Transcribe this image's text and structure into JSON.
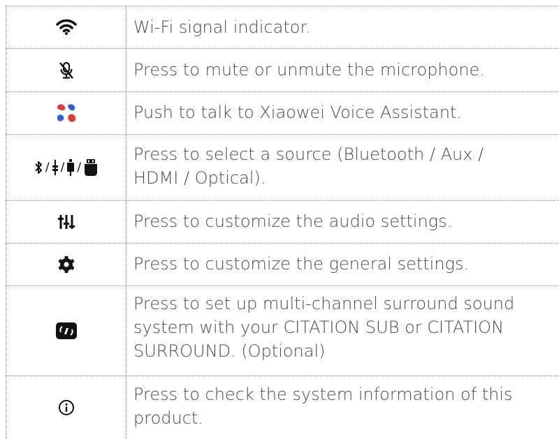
{
  "rows": [
    {
      "icon": "wifi-icon",
      "text": "Wi-Fi signal indicator."
    },
    {
      "icon": "microphone-mute-icon",
      "text": "Press to mute or unmute the microphone."
    },
    {
      "icon": "voice-assistant-icon",
      "text": "Push to talk to Xiaowei Voice Assistant."
    },
    {
      "icon": "source-icons",
      "text_lines": [
        "Press to select a source (Bluetooth / Aux /",
        "HDMI / Optical)."
      ]
    },
    {
      "icon": "audio-settings-icon",
      "text": "Press to customize the audio settings."
    },
    {
      "icon": "gear-icon",
      "text": "Press to customize the general settings."
    },
    {
      "icon": "surround-icon",
      "text_lines": [
        "Press to set up multi-channel surround sound",
        "system with your CITATION SUB or CITATION",
        "SURROUND. (Optional)"
      ]
    },
    {
      "icon": "info-icon",
      "text_lines": [
        "Press to check the system information of this",
        "product."
      ]
    }
  ],
  "source_separator": "/",
  "colors": {
    "voice_red": "#e23b3b",
    "voice_blue": "#2f5fd0",
    "text": "#4a4a4a",
    "icon": "#111111"
  }
}
